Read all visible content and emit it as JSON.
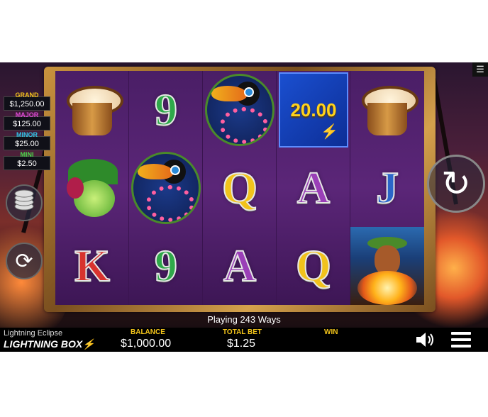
{
  "game": {
    "title": "Lightning Eclipse",
    "brand": "LIGHTNING BOX",
    "ways_text": "Playing 243 Ways"
  },
  "jackpots": [
    {
      "name": "GRAND",
      "amount": "$1,250.00",
      "color": "#f4c51a"
    },
    {
      "name": "MAJOR",
      "amount": "$125.00",
      "color": "#e04ad8"
    },
    {
      "name": "MINOR",
      "amount": "$25.00",
      "color": "#2ec6e8"
    },
    {
      "name": "MINI",
      "amount": "$2.50",
      "color": "#4ad84a"
    }
  ],
  "reels": [
    [
      "drum",
      "coconut",
      "K"
    ],
    [
      "9",
      "toucan",
      "9"
    ],
    [
      "toucan",
      "Q",
      "A"
    ],
    [
      "lightning",
      "A",
      "Q"
    ],
    [
      "drum",
      "J",
      "hula-dancer"
    ]
  ],
  "lightning_value": "20.00",
  "bottom_bar": {
    "balance_label": "BALANCE",
    "balance_value": "$1,000.00",
    "total_bet_label": "TOTAL BET",
    "total_bet_value": "$1.25",
    "win_label": "WIN",
    "win_value": ""
  },
  "icons": {
    "menu_top": "menu-icon",
    "stack": "coin-stack-icon",
    "autoplay": "autoplay-icon",
    "spin": "spin-icon",
    "sound": "speaker-icon",
    "menu": "hamburger-icon"
  },
  "colors": {
    "accent": "#f4c51a",
    "reel_bg": "#5b2678",
    "frame": "#c9933e"
  }
}
